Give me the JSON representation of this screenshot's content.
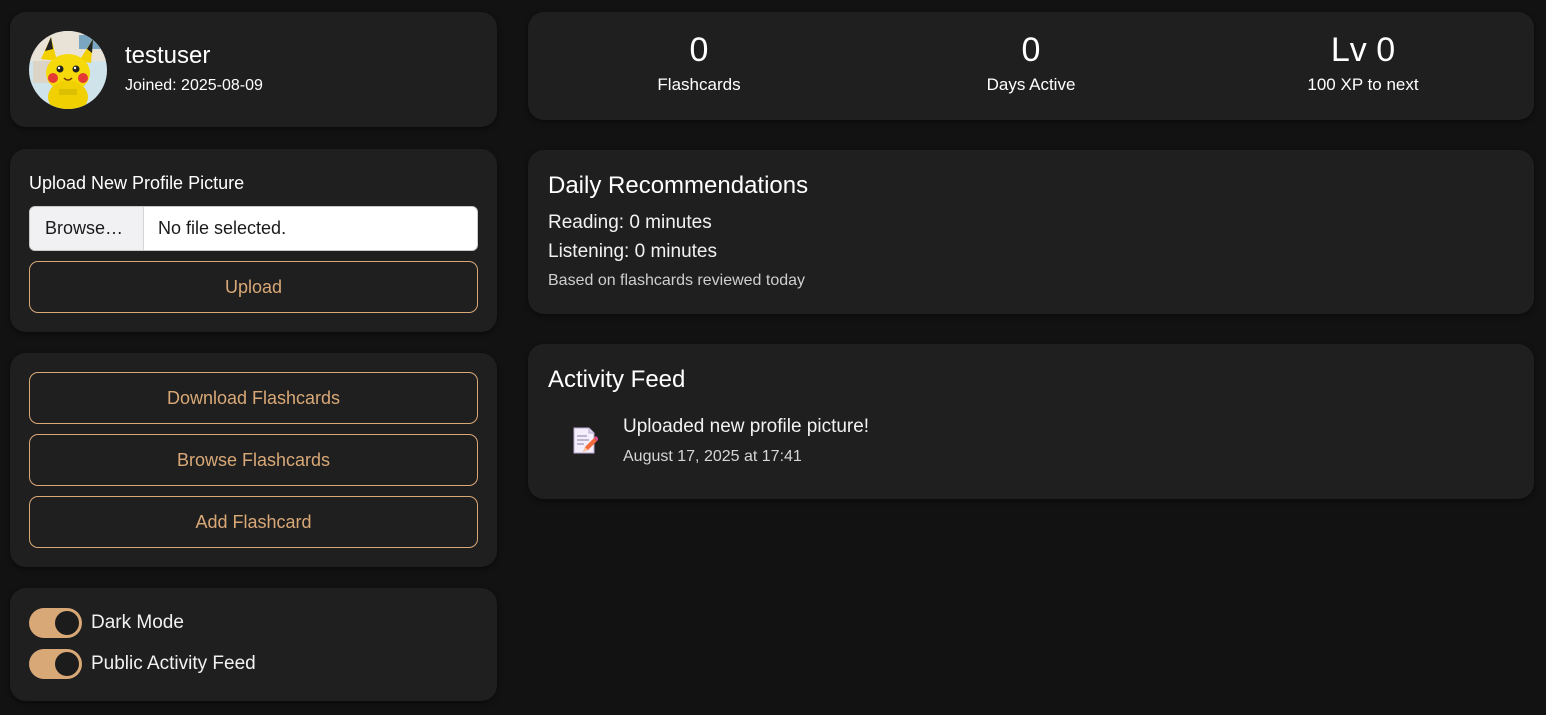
{
  "profile": {
    "username": "testuser",
    "joined": "Joined: 2025-08-09"
  },
  "upload": {
    "title": "Upload New Profile Picture",
    "browse_label": "Browse…",
    "file_status": "No file selected.",
    "upload_label": "Upload"
  },
  "actions": {
    "download_label": "Download Flashcards",
    "browse_label": "Browse Flashcards",
    "add_label": "Add Flashcard"
  },
  "settings": {
    "dark_mode_label": "Dark Mode",
    "dark_mode_on": true,
    "public_feed_label": "Public Activity Feed",
    "public_feed_on": true
  },
  "stats": [
    {
      "value": "0",
      "label": "Flashcards"
    },
    {
      "value": "0",
      "label": "Days Active"
    },
    {
      "value": "Lv 0",
      "label": "100 XP to next"
    }
  ],
  "recommendations": {
    "title": "Daily Recommendations",
    "reading": "Reading: 0 minutes",
    "listening": "Listening: 0 minutes",
    "note": "Based on flashcards reviewed today"
  },
  "activity": {
    "title": "Activity Feed",
    "items": [
      {
        "icon": "memo-icon",
        "text": "Uploaded new profile picture!",
        "time": "August 17, 2025 at 17:41"
      }
    ]
  },
  "colors": {
    "accent": "#d9a877",
    "background": "#121212",
    "card": "#1f1f1f"
  }
}
